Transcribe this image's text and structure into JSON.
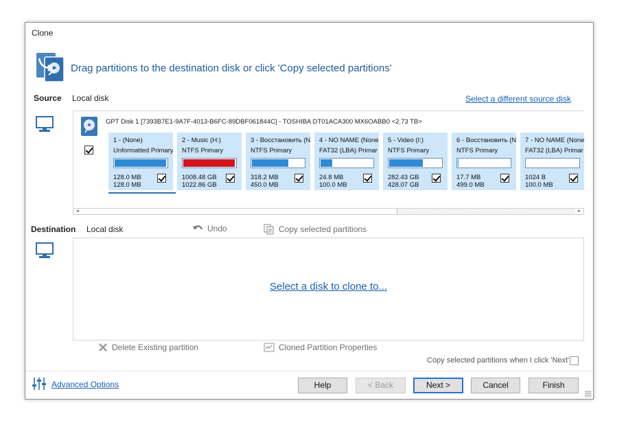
{
  "window": {
    "title": "Clone"
  },
  "header": {
    "instruction": "Drag partitions to the destination disk or click 'Copy selected partitions'"
  },
  "source": {
    "label": "Source",
    "disk_type": "Local disk",
    "change_link": "Select a different source disk",
    "disk_title": "GPT Disk 1 [7393B7E1-9A7F-4013-B6FC-89DBF061844C] - TOSHIBA DT01ACA300 MX6OABB0  <2.73 TB>",
    "disk_checked": true,
    "partitions": [
      {
        "name": "1 -  (None)",
        "type": "Unformatted Primary",
        "used": "128.0 MB",
        "total": "128.0 MB",
        "fill_percent": 99,
        "color": "#2f8ad6",
        "checked": true
      },
      {
        "name": "2 - Music (H:)",
        "type": "NTFS Primary",
        "used": "1008.48 GB",
        "total": "1022.86 GB",
        "fill_percent": 99,
        "color": "#d0141e",
        "checked": true
      },
      {
        "name": "3 - Восстановить (N",
        "type": "NTFS Primary",
        "used": "318.2 MB",
        "total": "450.0 MB",
        "fill_percent": 70,
        "color": "#2f8ad6",
        "checked": true
      },
      {
        "name": "4 - NO NAME (None",
        "type": "FAT32 (LBA) Primar",
        "used": "24.8 MB",
        "total": "100.0 MB",
        "fill_percent": 24,
        "color": "#2f8ad6",
        "checked": true
      },
      {
        "name": "5 - Video (I:)",
        "type": "NTFS Primary",
        "used": "282.43 GB",
        "total": "428.07 GB",
        "fill_percent": 66,
        "color": "#2f8ad6",
        "checked": true
      },
      {
        "name": "6 - Восстановить (N",
        "type": "NTFS Primary",
        "used": "17.7 MB",
        "total": "499.0 MB",
        "fill_percent": 3,
        "color": "#2f8ad6",
        "checked": true
      },
      {
        "name": "7 - NO NAME (None",
        "type": "FAT32 (LBA) Primar",
        "used": "1024 B",
        "total": "100.0 MB",
        "fill_percent": 0,
        "color": "#2f8ad6",
        "checked": true
      }
    ]
  },
  "destination": {
    "label": "Destination",
    "disk_type": "Local disk",
    "undo_label": "Undo",
    "copy_label": "Copy selected partitions",
    "select_link": "Select a disk to clone to...",
    "delete_label": "Delete Existing partition",
    "properties_label": "Cloned Partition Properties",
    "copy_on_next_label": "Copy selected partitions when I click 'Next'",
    "copy_on_next_checked": false
  },
  "footer": {
    "advanced_options": "Advanced Options",
    "help": "Help",
    "back": "< Back",
    "next": "Next >",
    "cancel": "Cancel",
    "finish": "Finish"
  },
  "icons": {
    "header": "disk-clone-icon",
    "source_monitor": "monitor-icon",
    "destination_monitor": "monitor-icon",
    "disk": "hard-disk-icon",
    "undo": "undo-icon",
    "copy": "copy-icon",
    "delete": "delete-x-icon",
    "properties": "properties-icon",
    "advanced": "sliders-icon"
  }
}
